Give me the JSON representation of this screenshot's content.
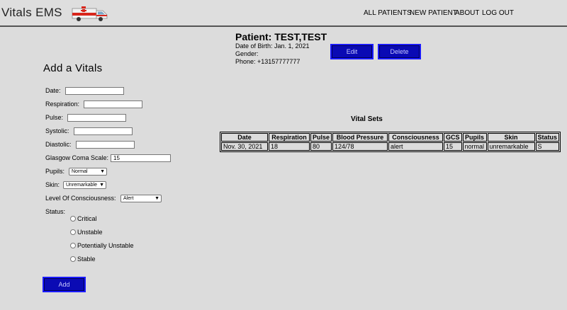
{
  "header": {
    "brand": "Vitals EMS",
    "nav": [
      "ALL PATIENTS",
      "NEW PATIENT",
      "ABOUT",
      "LOG OUT"
    ]
  },
  "patient": {
    "name": "Patient: TEST,TEST",
    "dob": "Date of Birth: Jan. 1, 2021",
    "gender": "Gender:",
    "phone": "Phone: +13157777777",
    "edit_label": "Edit",
    "delete_label": "Delete"
  },
  "form": {
    "title": "Add a Vitals",
    "date_label": "Date:",
    "respiration_label": "Respiration:",
    "pulse_label": "Pulse:",
    "systolic_label": "Systolic:",
    "diastolic_label": "Diastolic:",
    "gcs_label": "Glasgow Coma Scale:",
    "gcs_value": "15",
    "pupils_label": "Pupils:",
    "pupils_value": "Normal",
    "skin_label": "Skin:",
    "skin_value": "Unremarkable",
    "loc_label": "Level Of Consciousness:",
    "loc_value": "Alert",
    "status_label": "Status:",
    "status_options": [
      "Critical",
      "Unstable",
      "Potentially Unstable",
      "Stable"
    ],
    "add_label": "Add"
  },
  "vital_sets": {
    "title": "Vital Sets",
    "columns": [
      "Date",
      "Respiration",
      "Pulse",
      "Blood Pressure",
      "Consciousness",
      "GCS",
      "Pupils",
      "Skin",
      "Status"
    ],
    "rows": [
      [
        "Nov. 30, 2021",
        "18",
        "80",
        "124/78",
        "alert",
        "15",
        "normal",
        "unremarkable",
        "S"
      ]
    ]
  },
  "colors": {
    "button_bg": "#0a0ab4",
    "ambulance_red": "#d8261c"
  }
}
